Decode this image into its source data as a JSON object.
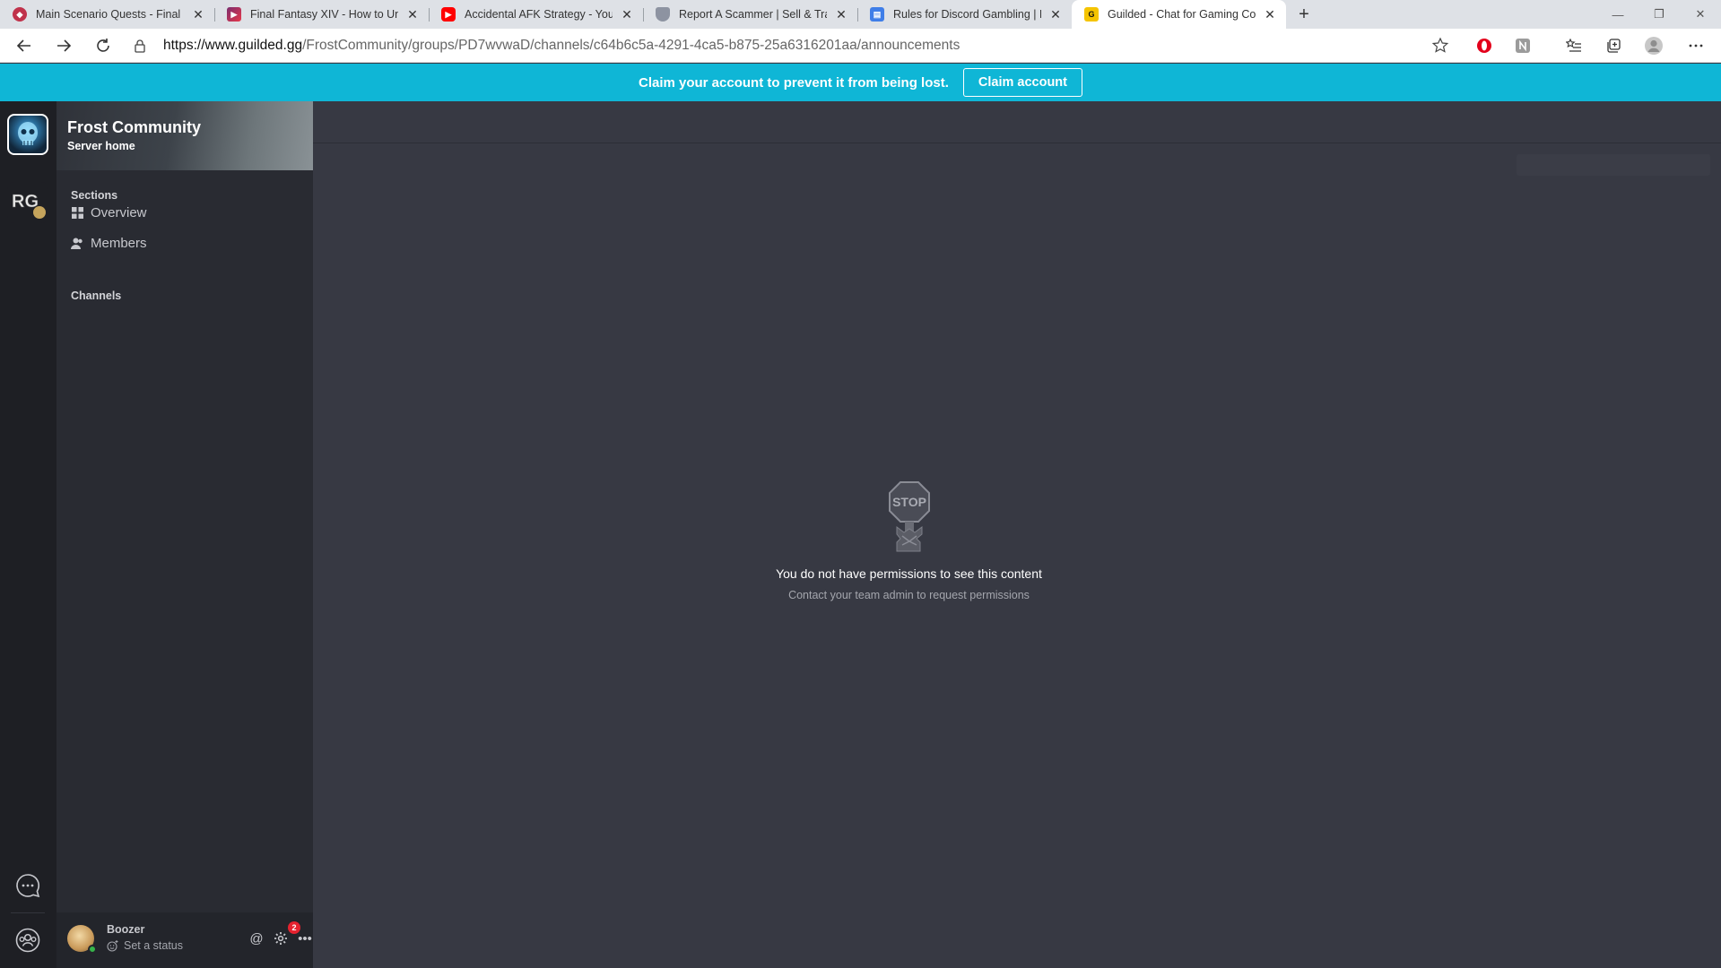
{
  "browser": {
    "tabs": [
      {
        "title": "Main Scenario Quests - Final Fan",
        "favicon": "ff-wiki-favicon",
        "active": false
      },
      {
        "title": "Final Fantasy XIV - How to Unloc",
        "favicon": "video-site-favicon",
        "active": false
      },
      {
        "title": "Accidental AFK Strategy - YouTu",
        "favicon": "youtube-favicon",
        "active": false
      },
      {
        "title": "Report A Scammer | Sell & Trade",
        "favicon": "shield-favicon",
        "active": false
      },
      {
        "title": "Rules for Discord Gambling | Fro",
        "favicon": "google-docs-favicon",
        "active": false
      },
      {
        "title": "Guilded - Chat for Gaming Comm",
        "favicon": "guilded-favicon",
        "active": true
      }
    ],
    "new_tab_label": "+",
    "url_host": "https://www.guilded.gg",
    "url_path": "/FrostCommunity/groups/PD7wvwaD/channels/c64b6c5a-4291-4ca5-b875-25a6316201aa/announcements"
  },
  "banner": {
    "text": "Claim your account to prevent it from being lost.",
    "button_label": "Claim account",
    "color": "#0fb6d6"
  },
  "server": {
    "name": "Frost Community",
    "subtitle": "Server home"
  },
  "sidebar": {
    "sections_title": "Sections",
    "items": [
      {
        "label": "Overview",
        "icon": "grid-icon"
      },
      {
        "label": "Members",
        "icon": "members-icon"
      }
    ],
    "channels_title": "Channels"
  },
  "user": {
    "name": "Boozer",
    "status_placeholder": "Set a status",
    "notification_count": "2",
    "status_color": "#36b44a"
  },
  "content": {
    "icon": "stop-sign-icon",
    "title": "You do not have permissions to see this content",
    "subtitle": "Contact your team admin to request permissions"
  }
}
